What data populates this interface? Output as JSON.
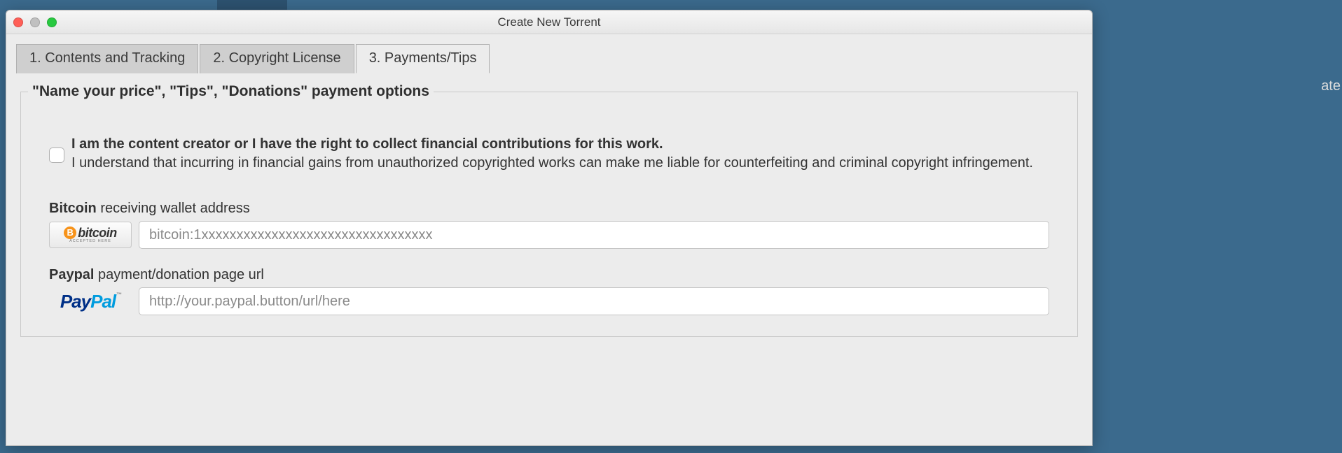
{
  "window": {
    "title": "Create New Torrent"
  },
  "tabs": [
    {
      "label": "1. Contents and Tracking",
      "active": false
    },
    {
      "label": "2. Copyright License",
      "active": false
    },
    {
      "label": "3. Payments/Tips",
      "active": true
    }
  ],
  "group": {
    "title": "\"Name your price\", \"Tips\", \"Donations\" payment options"
  },
  "disclaimer": {
    "line1": "I am the content creator or I have the right to collect financial contributions for this work.",
    "line2": "I understand that incurring in financial gains from unauthorized copyrighted works can make me liable for counterfeiting and criminal copyright infringement.",
    "checked": false
  },
  "bitcoin": {
    "label_strong": "Bitcoin",
    "label_rest": " receiving wallet address",
    "logo_text": "bitcoin",
    "logo_sub": "ACCEPTED HERE",
    "value": "",
    "placeholder": "bitcoin:1xxxxxxxxxxxxxxxxxxxxxxxxxxxxxxxxx"
  },
  "paypal": {
    "label_strong": "Paypal",
    "label_rest": " payment/donation page url",
    "logo_part1": "Pay",
    "logo_part2": "Pal",
    "value": "",
    "placeholder": "http://your.paypal.button/url/here"
  },
  "background_fragment": "ate"
}
